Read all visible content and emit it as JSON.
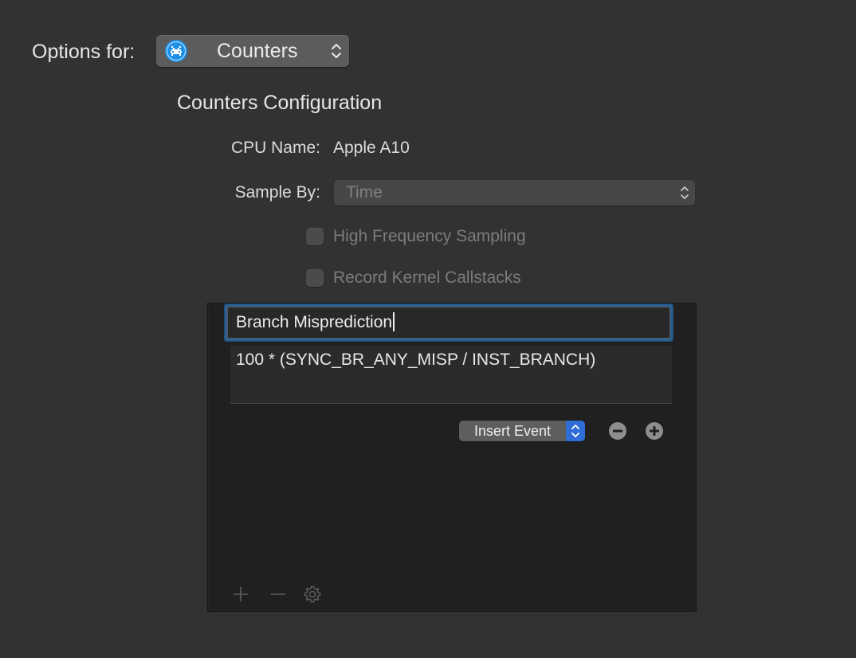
{
  "options": {
    "label": "Options for:",
    "instrument": {
      "name": "Counters",
      "icon": "counters-instrument-icon"
    }
  },
  "config": {
    "title": "Counters Configuration",
    "cpu_name_label": "CPU Name:",
    "cpu_name_value": "Apple A10",
    "sample_by_label": "Sample By:",
    "sample_by_value": "Time",
    "high_frequency_sampling": {
      "label": "High Frequency Sampling",
      "checked": false,
      "enabled": false
    },
    "record_kernel_callstacks": {
      "label": "Record Kernel Callstacks",
      "checked": false,
      "enabled": false
    }
  },
  "formula_editor": {
    "name_value": "Branch Misprediction",
    "formula_value": "100 * (SYNC_BR_ANY_MISP / INST_BRANCH)",
    "insert_event_label": "Insert Event",
    "remove_icon": "minus-circle-icon",
    "add_icon": "plus-circle-icon"
  },
  "footer": {
    "add_icon": "plus-icon",
    "remove_icon": "minus-icon",
    "settings_icon": "gear-icon"
  },
  "colors": {
    "background": "#323232",
    "panel": "#202020",
    "focus_ring": "#2a5f92",
    "accent": "#2e6ed6",
    "instrument_icon": "#1e90e8"
  }
}
